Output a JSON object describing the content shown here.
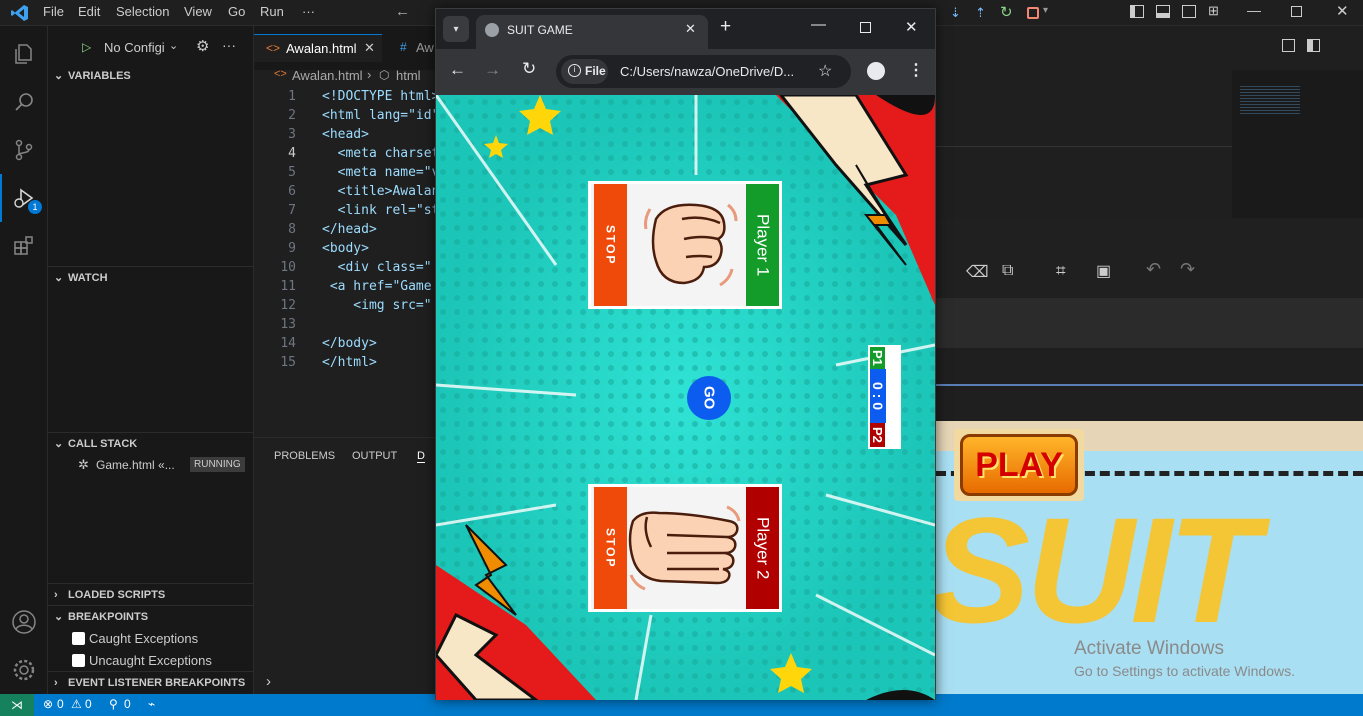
{
  "vscode": {
    "menu": [
      "File",
      "Edit",
      "Selection",
      "View",
      "Go",
      "Run",
      "···"
    ],
    "debug": {
      "config_label": "No Configi",
      "run_icon": "play-icon",
      "badge": "1"
    },
    "sections": {
      "variables": "VARIABLES",
      "watch": "WATCH",
      "call_stack": "CALL STACK",
      "loaded_scripts": "LOADED SCRIPTS",
      "breakpoints": "BREAKPOINTS",
      "event_listener_breakpoints": "EVENT LISTENER BREAKPOINTS"
    },
    "call_stack_item": {
      "label": "Game.html «...",
      "status": "RUNNING"
    },
    "breakpoints": [
      {
        "label": "Caught Exceptions",
        "checked": false
      },
      {
        "label": "Uncaught Exceptions",
        "checked": false
      }
    ],
    "tabs": [
      {
        "label": "Awalan.html",
        "active": true
      },
      {
        "label": "Aw",
        "active": false
      }
    ],
    "breadcrumb": {
      "file": "Awalan.html",
      "node": "html"
    },
    "code_lines": [
      {
        "n": "1",
        "text": "<!DOCTYPE html>"
      },
      {
        "n": "2",
        "text": "<html lang=\"id\">"
      },
      {
        "n": "3",
        "text": "<head>"
      },
      {
        "n": "4",
        "text": "  <meta charset"
      },
      {
        "n": "5",
        "text": "  <meta name=\"v"
      },
      {
        "n": "6",
        "text": "  <title>Awalan"
      },
      {
        "n": "7",
        "text": "  <link rel=\"st"
      },
      {
        "n": "8",
        "text": "</head>"
      },
      {
        "n": "9",
        "text": "<body>"
      },
      {
        "n": "10",
        "text": "  <div class=\""
      },
      {
        "n": "11",
        "text": " <a href=\"Game"
      },
      {
        "n": "12",
        "text": "    <img src=\""
      },
      {
        "n": "13",
        "text": ""
      },
      {
        "n": "14",
        "text": "</body>"
      },
      {
        "n": "15",
        "text": "</html>"
      }
    ],
    "panel_tabs": [
      "PROBLEMS",
      "OUTPUT",
      "D"
    ],
    "status": {
      "errors": "0",
      "warnings": "0",
      "ports": "0"
    }
  },
  "browser": {
    "tab_title": "SUIT GAME",
    "address_scheme": "File",
    "address": "C:/Users/nawza/OneDrive/D...",
    "game": {
      "player1": {
        "label": "Player 1",
        "stop": "STOP",
        "hand": "rock"
      },
      "player2": {
        "label": "Player 2",
        "stop": "STOP",
        "hand": "paper"
      },
      "go": "GO",
      "score": {
        "p1": "P1",
        "value": "0 : 0",
        "p2": "P2"
      }
    }
  },
  "background_app": {
    "play_label": "PLAY",
    "suit_label": "SUIT",
    "activate_title": "Activate Windows",
    "activate_sub": "Go to Settings to activate Windows."
  },
  "colors": {
    "accent": "#007acc",
    "game_bg": "#21d2c4",
    "stop_orange": "#f04a0b",
    "p1_green": "#149c2a",
    "p2_red": "#b00000",
    "go_blue": "#0d5cf0"
  }
}
